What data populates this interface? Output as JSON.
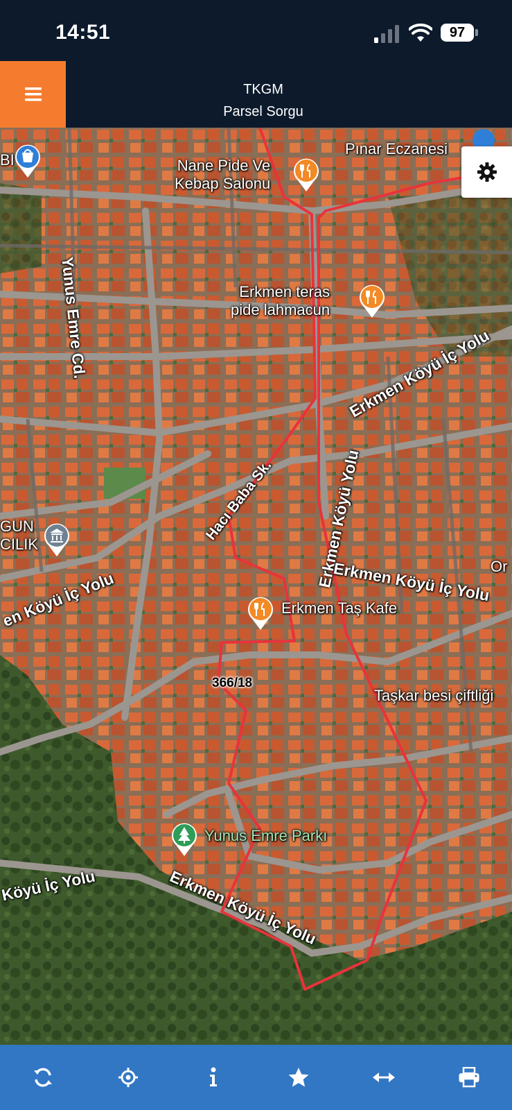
{
  "status_bar": {
    "time": "14:51",
    "battery": "97",
    "icons": [
      "signal-icon",
      "wifi-icon",
      "battery-icon"
    ]
  },
  "header": {
    "title": "TKGM",
    "subtitle": "Parsel Sorgu",
    "menu_icon": "hamburger-menu-icon",
    "accent_color": "#f57c2f",
    "background_color": "#0c1a2c"
  },
  "map": {
    "settings_icon": "gear-icon",
    "parcel_label": "366/18",
    "parcel_outline_color": "#e8333b",
    "pois": [
      {
        "name": "Nane Pide Ve\nKebap Salonu",
        "icon": "restaurant-icon"
      },
      {
        "name": "Pınar Eczanesi",
        "icon": "pharmacy-icon"
      },
      {
        "name": "Erkmen teras\npide lahmacun",
        "icon": "restaurant-icon"
      },
      {
        "name": "Erkmen Taş Kafe",
        "icon": "restaurant-icon"
      },
      {
        "name": "Yunus Emre Parkı",
        "icon": "park-icon"
      },
      {
        "name": "Taşkar besi çiftliği",
        "icon": ""
      },
      {
        "name": "BI",
        "icon": "shopping-icon"
      },
      {
        "name": "GUN\nCILIK",
        "icon": "institution-icon"
      },
      {
        "name": "Or",
        "icon": ""
      }
    ],
    "roads": [
      "Yunus Emre Cd.",
      "Erkmen Köyü İç Yolu",
      "Hacı Baba Sk.",
      "Erkmen Köyü Yolu",
      "Erkmen Köyü İç Yolu",
      "en Köyü İç Yolu",
      "Köyü İç Yolu",
      "Erkmen Köyü İç Yolu"
    ]
  },
  "toolbar": {
    "background_color": "#3277c4",
    "buttons": [
      {
        "icon": "refresh-icon"
      },
      {
        "icon": "locate-icon"
      },
      {
        "icon": "info-icon"
      },
      {
        "icon": "star-icon"
      },
      {
        "icon": "measure-icon"
      },
      {
        "icon": "print-icon"
      }
    ]
  }
}
